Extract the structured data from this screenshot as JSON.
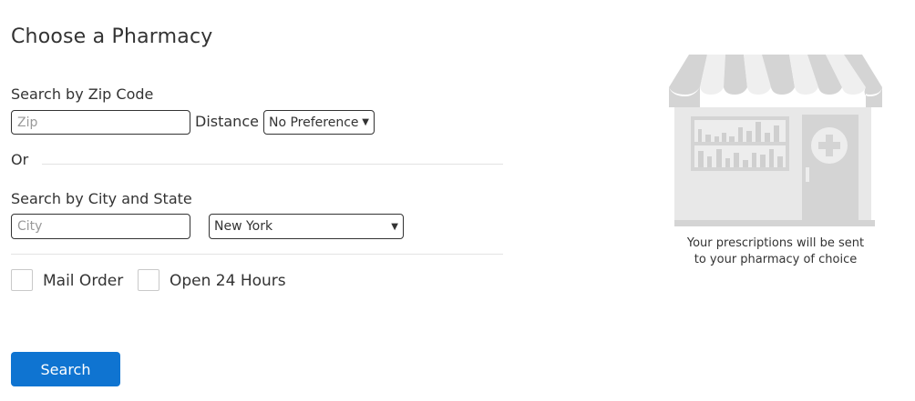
{
  "page": {
    "title": "Choose a Pharmacy"
  },
  "zip_section": {
    "label": "Search by Zip Code",
    "zip_placeholder": "Zip",
    "distance_label": "Distance",
    "distance_value": "No Preference"
  },
  "or_label": "Or",
  "city_section": {
    "label": "Search by City and State",
    "city_placeholder": "City",
    "state_value": "New York"
  },
  "filters": {
    "mail_order_label": "Mail Order",
    "open_24_label": "Open 24 Hours"
  },
  "search_button_label": "Search",
  "illustration": {
    "caption_line1": "Your prescriptions will be sent",
    "caption_line2": "to your pharmacy of choice",
    "icon": "pharmacy-storefront-icon"
  }
}
